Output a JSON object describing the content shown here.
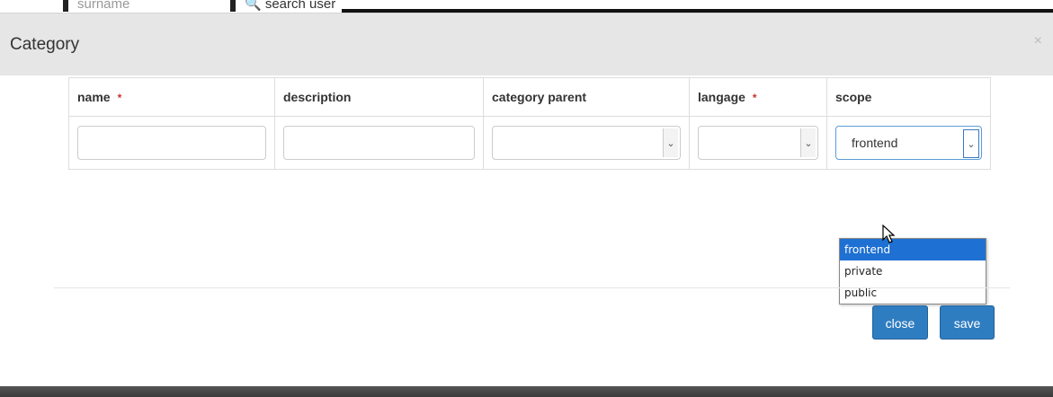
{
  "background": {
    "surname_placeholder": "surname",
    "search_user_label": "🔍 search user"
  },
  "modal": {
    "title": "Category",
    "close_icon": "×"
  },
  "table": {
    "headers": {
      "name": "name",
      "description": "description",
      "category_parent": "category parent",
      "langage": "langage",
      "scope": "scope"
    },
    "required_marker": "*",
    "scope_value": "frontend"
  },
  "dropdown": {
    "options": [
      "frontend",
      "private",
      "public"
    ],
    "selected_index": 0
  },
  "buttons": {
    "close": "close",
    "save": "save"
  },
  "colors": {
    "primary": "#2f7dc1",
    "selected_option": "#1e70d2",
    "required": "#c9302c",
    "header_bg": "#e6e6e6"
  }
}
